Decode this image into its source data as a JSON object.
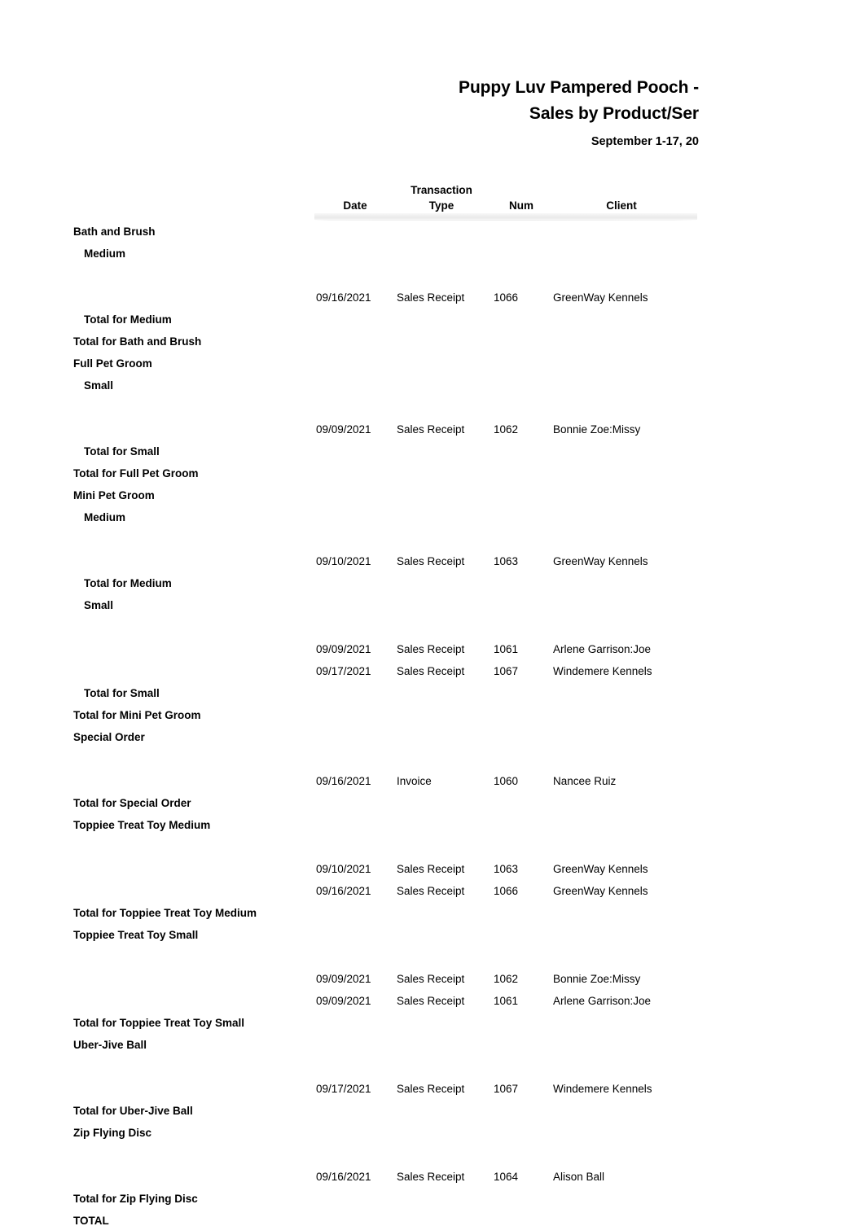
{
  "report": {
    "title_line_1": "Puppy Luv Pampered Pooch -",
    "title_line_2": "Sales by  Product/Ser",
    "subtitle": "September 1-17, 20"
  },
  "columns": {
    "date": "Date",
    "transaction_type_line1": "Transaction",
    "transaction_type_line2": "Type",
    "num": "Num",
    "client": "Client"
  },
  "rows": [
    {
      "kind": "group",
      "level": 0,
      "label": "Bath and Brush"
    },
    {
      "kind": "group",
      "level": 1,
      "label": "Medium"
    },
    {
      "kind": "data",
      "date": "09/16/2021",
      "type": "Sales Receipt",
      "num": "1066",
      "client": "GreenWay Kennels"
    },
    {
      "kind": "total",
      "level": 1,
      "label": "Total for Medium"
    },
    {
      "kind": "total",
      "level": 0,
      "label": "Total for Bath and Brush"
    },
    {
      "kind": "group",
      "level": 0,
      "label": "Full Pet Groom"
    },
    {
      "kind": "group",
      "level": 1,
      "label": "Small"
    },
    {
      "kind": "data",
      "date": "09/09/2021",
      "type": "Sales Receipt",
      "num": "1062",
      "client": "Bonnie Zoe:Missy"
    },
    {
      "kind": "total",
      "level": 1,
      "label": "Total for Small"
    },
    {
      "kind": "total",
      "level": 0,
      "label": "Total for Full Pet Groom"
    },
    {
      "kind": "group",
      "level": 0,
      "label": "Mini Pet Groom"
    },
    {
      "kind": "group",
      "level": 1,
      "label": "Medium"
    },
    {
      "kind": "data",
      "date": "09/10/2021",
      "type": "Sales Receipt",
      "num": "1063",
      "client": "GreenWay Kennels"
    },
    {
      "kind": "total",
      "level": 1,
      "label": "Total for Medium"
    },
    {
      "kind": "group",
      "level": 1,
      "label": "Small"
    },
    {
      "kind": "data",
      "date": "09/09/2021",
      "type": "Sales Receipt",
      "num": "1061",
      "client": "Arlene Garrison:Joe"
    },
    {
      "kind": "data",
      "date": "09/17/2021",
      "type": "Sales Receipt",
      "num": "1067",
      "client": "Windemere Kennels"
    },
    {
      "kind": "total",
      "level": 1,
      "label": "Total for Small"
    },
    {
      "kind": "total",
      "level": 0,
      "label": "Total for Mini Pet Groom"
    },
    {
      "kind": "group",
      "level": 0,
      "label": "Special Order"
    },
    {
      "kind": "data",
      "date": "09/16/2021",
      "type": "Invoice",
      "num": "1060",
      "client": "Nancee Ruiz"
    },
    {
      "kind": "total",
      "level": 0,
      "label": "Total for Special Order"
    },
    {
      "kind": "group",
      "level": 0,
      "label": "Toppiee Treat Toy Medium"
    },
    {
      "kind": "data",
      "date": "09/10/2021",
      "type": "Sales Receipt",
      "num": "1063",
      "client": "GreenWay Kennels"
    },
    {
      "kind": "data",
      "date": "09/16/2021",
      "type": "Sales Receipt",
      "num": "1066",
      "client": "GreenWay Kennels"
    },
    {
      "kind": "total",
      "level": 0,
      "label": "Total for Toppiee Treat Toy Medium"
    },
    {
      "kind": "group",
      "level": 0,
      "label": "Toppiee Treat Toy Small"
    },
    {
      "kind": "data",
      "date": "09/09/2021",
      "type": "Sales Receipt",
      "num": "1062",
      "client": "Bonnie Zoe:Missy"
    },
    {
      "kind": "data",
      "date": "09/09/2021",
      "type": "Sales Receipt",
      "num": "1061",
      "client": "Arlene Garrison:Joe"
    },
    {
      "kind": "total",
      "level": 0,
      "label": "Total for Toppiee Treat Toy Small"
    },
    {
      "kind": "group",
      "level": 0,
      "label": "Uber-Jive Ball"
    },
    {
      "kind": "data",
      "date": "09/17/2021",
      "type": "Sales Receipt",
      "num": "1067",
      "client": "Windemere Kennels"
    },
    {
      "kind": "total",
      "level": 0,
      "label": "Total for Uber-Jive Ball"
    },
    {
      "kind": "group",
      "level": 0,
      "label": "Zip Flying Disc"
    },
    {
      "kind": "data",
      "date": "09/16/2021",
      "type": "Sales Receipt",
      "num": "1064",
      "client": "Alison Ball"
    },
    {
      "kind": "total",
      "level": 0,
      "label": "Total for Zip Flying Disc"
    },
    {
      "kind": "total",
      "level": 0,
      "label": "TOTAL"
    }
  ]
}
